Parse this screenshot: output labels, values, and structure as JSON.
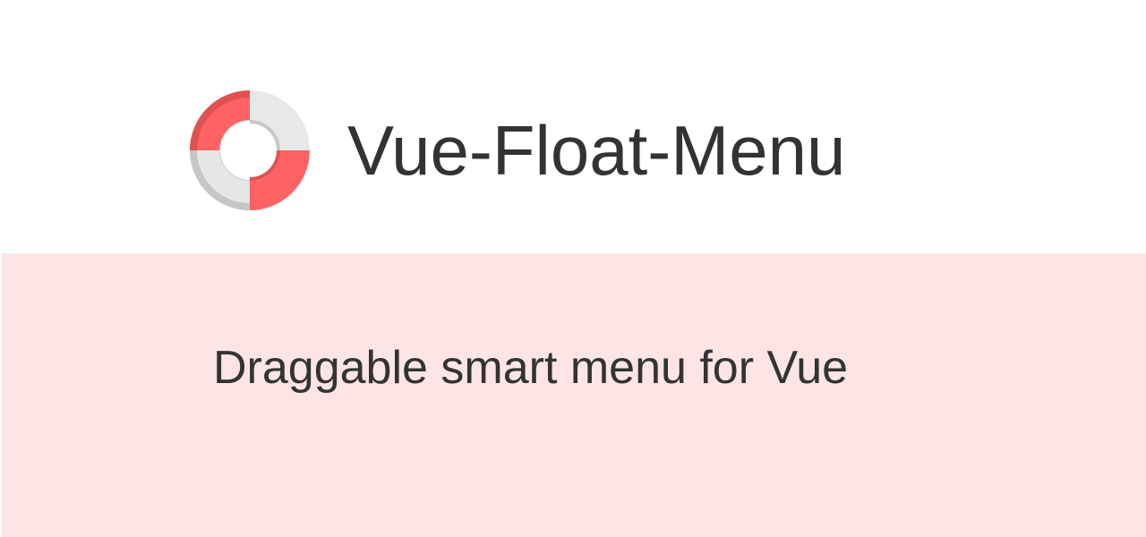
{
  "header": {
    "title": "Vue-Float-Menu",
    "logo_icon": "lifebuoy-icon"
  },
  "hero": {
    "tagline": "Draggable smart menu for Vue",
    "background_color": "#fde5e6"
  },
  "colors": {
    "accent": "#ff6262",
    "accent_dark": "#e05252",
    "ring_light": "#e8e8e8",
    "ring_shadow": "#c4c4c4",
    "text": "#333333"
  }
}
